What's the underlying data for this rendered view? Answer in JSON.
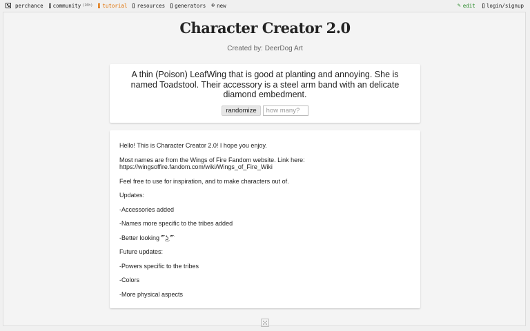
{
  "topbar": {
    "brand_label": "perchance",
    "nav": {
      "community_label": "community",
      "community_badge": "(10h)",
      "tutorial_label": "tutorial",
      "resources_label": "resources",
      "generators_label": "generators",
      "new_label": "new"
    },
    "right": {
      "edit_label": "edit",
      "login_label": "login/signup"
    }
  },
  "header": {
    "title": "Character Creator 2.0",
    "subtitle": "Created by: DeerDog Art"
  },
  "generator": {
    "output": "A thin (Poison) LeafWing that is good at planting and annoying. She is named Toadstool. Their accessory is a steel arm band with an delicate diamond embedment.",
    "randomize_label": "randomize",
    "count_placeholder": "how many?"
  },
  "description": {
    "p1": "Hello! This is Character Creator 2.0! I hope you enjoy.",
    "p2_text": "Most names are from the Wings of Fire Fandom website. Link here:",
    "p2_link": "https://wingsoffire.fandom.com/wiki/Wings_of_Fire_Wiki",
    "p3": "Feel free to use for inspiration, and to make characters out of.",
    "p4": "Updates:",
    "p5": "-Accessories added",
    "p6": "-Names more specific to the tribes added",
    "p7": "-Better looking ͡° ͜ʖ ͡°",
    "p8": "Future updates:",
    "p9": "-Powers specific to the tribes",
    "p10": "-Colors",
    "p11": "-More physical aspects"
  },
  "colors": {
    "accent_active": "#e07000",
    "edit_green": "#2a8a2a",
    "page_background": "#f0f0f0"
  },
  "icons": [
    "dice-logo-icon",
    "community-icon",
    "tutorial-icon",
    "resources-icon",
    "generators-icon",
    "plus-circle-icon",
    "edit-icon",
    "login-icon",
    "footer-dice-icon"
  ]
}
